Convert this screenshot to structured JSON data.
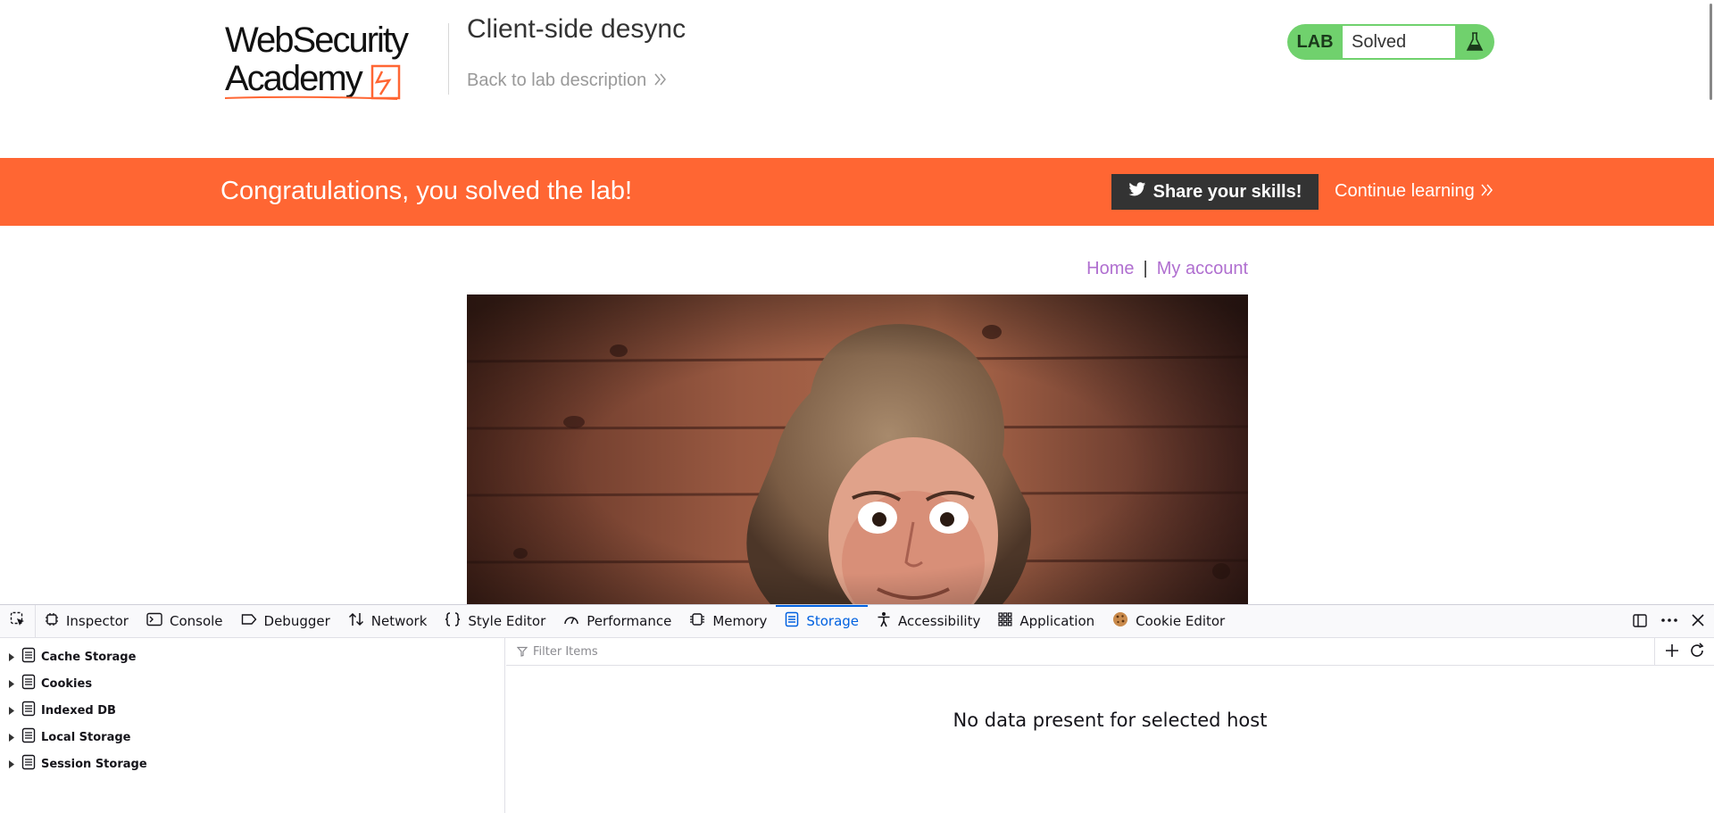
{
  "header": {
    "logo_line1": "WebSecurity",
    "logo_line2": "Academy",
    "lab_title": "Client-side desync",
    "back_link": "Back to lab description",
    "status_label": "LAB",
    "status_value": "Solved",
    "status_color": "#70d16d"
  },
  "banner": {
    "message": "Congratulations, you solved the lab!",
    "share_button": "Share your skills!",
    "continue_link": "Continue learning",
    "color": "#ff6633"
  },
  "nav": {
    "home": "Home",
    "separator": "|",
    "account": "My account"
  },
  "devtools": {
    "tabs": [
      {
        "label": "Inspector",
        "icon": "inspector-icon"
      },
      {
        "label": "Console",
        "icon": "console-icon"
      },
      {
        "label": "Debugger",
        "icon": "debugger-icon"
      },
      {
        "label": "Network",
        "icon": "network-icon"
      },
      {
        "label": "Style Editor",
        "icon": "style-editor-icon"
      },
      {
        "label": "Performance",
        "icon": "performance-icon"
      },
      {
        "label": "Memory",
        "icon": "memory-icon"
      },
      {
        "label": "Storage",
        "icon": "storage-icon",
        "active": true
      },
      {
        "label": "Accessibility",
        "icon": "accessibility-icon"
      },
      {
        "label": "Application",
        "icon": "application-icon"
      },
      {
        "label": "Cookie Editor",
        "icon": "cookie-icon"
      }
    ],
    "storage_tree": [
      "Cache Storage",
      "Cookies",
      "Indexed DB",
      "Local Storage",
      "Session Storage"
    ],
    "filter_placeholder": "Filter Items",
    "empty_message": "No data present for selected host",
    "accent_color": "#0061e0"
  }
}
